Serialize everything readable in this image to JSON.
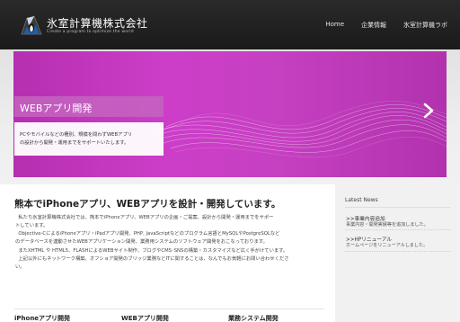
{
  "header": {
    "logo_title": "氷室計算機株式会社",
    "logo_tagline": "Create a program to optimize the world",
    "nav": [
      "Home",
      "企業情報",
      "氷室計算機ラボ"
    ]
  },
  "hero": {
    "caption_title": "WEBアプリ開発",
    "caption_line1": "PCやモバイルなどの種別、規模を問わずWEBアプリ",
    "caption_line2": "の設計から開発・運用までをサポートいたします。"
  },
  "main": {
    "title": "熊本でiPhoneアプリ、WEBアプリを設計・開発しています。",
    "paragraphs": [
      "私たち氷室計算機株式会社では、熊本でiPhoneアプリ、WEBアプリの企画・ご提案、設計から開発・運用までをサポー",
      "トしています。",
      "Objective-CによるiPhoneアプリ・iPadアプリ開発、PHP, JavaScriptなどのプログラム言語とMySQLやPostgreSQLなど",
      "のデータベースを連動させたWEBアプリケーション開発、業務用システムのソフトウェア開発をおこなっております。",
      "またXHTML や HTML5、FLASHによるWEBサイト制作、ブログやCMS･SNSの構築・カスタマイズなど広く手がけています。",
      "上記以外にもネットワーク構築、オフショア開発のブリッジ業務などITに関することは、なんでもお気軽にお問い合わせくださ",
      "い。"
    ]
  },
  "sidebar": {
    "heading": "Latest News",
    "news": [
      {
        "title": ">>事業内容追加",
        "body": "事業内容・開発実績等を追加しました。"
      },
      {
        "title": ">>HPリニューアル",
        "body": "ホームページをリニューアルしました。"
      }
    ]
  },
  "columns": [
    "iPhoneアプリ開発",
    "WEBアプリ開発",
    "業務システム開発"
  ],
  "colors": {
    "header_bg": "#1f1f1f",
    "slider_magenta": "#c23bbe",
    "caption_band": "#c364be",
    "sidebar_bg": "#f1f1f1"
  },
  "icons": {
    "logo": "penguin-logo-icon",
    "next": "chevron-right-icon"
  }
}
